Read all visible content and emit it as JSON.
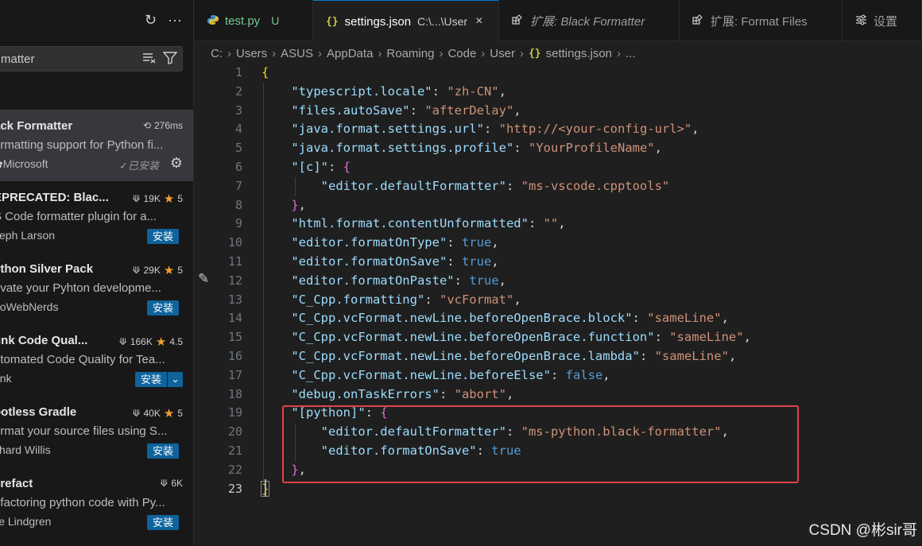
{
  "sidebar": {
    "actions": {
      "refresh_icon": "refresh-icon",
      "more_icon": "more-icon"
    },
    "search": {
      "value": "matter",
      "icons": [
        "clear-filter-icon",
        "filter-icon"
      ]
    },
    "extensions": [
      {
        "name": "ack Formatter",
        "description": "ormatting support for Python fi...",
        "publisher": "Microsoft",
        "stats": "276ms",
        "stat_icon": "history-icon",
        "status": "✓已安装",
        "selected": true
      },
      {
        "name": "EPRECATED: Blac...",
        "description": "S Code formatter plugin for a...",
        "publisher": "seph Larson",
        "downloads": "19K",
        "rating": "5",
        "install_label": "安装"
      },
      {
        "name": "ython Silver Pack",
        "description": "evate your Pyhton developme...",
        "publisher": "hoWebNerds",
        "downloads": "29K",
        "rating": "5",
        "install_label": "安装"
      },
      {
        "name": "unk Code Qual...",
        "description": "utomated Code Quality for Tea...",
        "publisher": "unk",
        "downloads": "166K",
        "rating": "4.5",
        "install_label": "安装",
        "split": true
      },
      {
        "name": "ootless Gradle",
        "description": "ormat your source files using S...",
        "publisher": "chard Willis",
        "downloads": "40K",
        "rating": "5",
        "install_label": "安装"
      },
      {
        "name": "yrefact",
        "description": "efactoring python code with Py...",
        "publisher": "lle Lindgren",
        "downloads": "6K",
        "install_label": "安装"
      }
    ]
  },
  "tabs": [
    {
      "icon": "python-icon",
      "label": "test.py",
      "badge": "U"
    },
    {
      "icon": "json-icon",
      "icon_text": "{}",
      "label": "settings.json",
      "path": "C:\\...\\User",
      "close": "×",
      "active": true
    },
    {
      "icon": "extension-icon",
      "label": "扩展: Black Formatter"
    },
    {
      "icon": "extension-icon",
      "label": "扩展: Format Files"
    },
    {
      "icon": "settings-icon",
      "label": "设置"
    }
  ],
  "breadcrumb": {
    "parts": [
      "C:",
      "Users",
      "ASUS",
      "AppData",
      "Roaming",
      "Code",
      "User"
    ],
    "file": "settings.json",
    "tail": "..."
  },
  "editor": {
    "line_numbers": [
      "1",
      "2",
      "3",
      "4",
      "5",
      "6",
      "7",
      "8",
      "9",
      "10",
      "11",
      "12",
      "13",
      "14",
      "15",
      "16",
      "17",
      "18",
      "19",
      "20",
      "21",
      "22",
      "23"
    ],
    "current_line": "23",
    "lines": [
      [
        [
          "br1",
          "{"
        ]
      ],
      [
        [
          "p",
          "    "
        ],
        [
          "k",
          "\"typescript.locale\""
        ],
        [
          "p",
          ": "
        ],
        [
          "s",
          "\"zh-CN\""
        ],
        [
          "p",
          ","
        ]
      ],
      [
        [
          "p",
          "    "
        ],
        [
          "k",
          "\"files.autoSave\""
        ],
        [
          "p",
          ": "
        ],
        [
          "s",
          "\"afterDelay\""
        ],
        [
          "p",
          ","
        ]
      ],
      [
        [
          "p",
          "    "
        ],
        [
          "k",
          "\"java.format.settings.url\""
        ],
        [
          "p",
          ": "
        ],
        [
          "s",
          "\"http://<your-config-url>\""
        ],
        [
          "p",
          ","
        ]
      ],
      [
        [
          "p",
          "    "
        ],
        [
          "k",
          "\"java.format.settings.profile\""
        ],
        [
          "p",
          ": "
        ],
        [
          "s",
          "\"YourProfileName\""
        ],
        [
          "p",
          ","
        ]
      ],
      [
        [
          "p",
          "    "
        ],
        [
          "k",
          "\"[c]\""
        ],
        [
          "p",
          ": "
        ],
        [
          "br2",
          "{"
        ]
      ],
      [
        [
          "p",
          "        "
        ],
        [
          "k",
          "\"editor.defaultFormatter\""
        ],
        [
          "p",
          ": "
        ],
        [
          "s",
          "\"ms-vscode.cpptools\""
        ]
      ],
      [
        [
          "p",
          "    "
        ],
        [
          "br2",
          "}"
        ],
        [
          "p",
          ","
        ]
      ],
      [
        [
          "p",
          "    "
        ],
        [
          "k",
          "\"html.format.contentUnformatted\""
        ],
        [
          "p",
          ": "
        ],
        [
          "s",
          "\"\""
        ],
        [
          "p",
          ","
        ]
      ],
      [
        [
          "p",
          "    "
        ],
        [
          "k",
          "\"editor.formatOnType\""
        ],
        [
          "p",
          ": "
        ],
        [
          "b",
          "true"
        ],
        [
          "p",
          ","
        ]
      ],
      [
        [
          "p",
          "    "
        ],
        [
          "k",
          "\"editor.formatOnSave\""
        ],
        [
          "p",
          ": "
        ],
        [
          "b",
          "true"
        ],
        [
          "p",
          ","
        ]
      ],
      [
        [
          "p",
          "    "
        ],
        [
          "k",
          "\"editor.formatOnPaste\""
        ],
        [
          "p",
          ": "
        ],
        [
          "b",
          "true"
        ],
        [
          "p",
          ","
        ]
      ],
      [
        [
          "p",
          "    "
        ],
        [
          "k",
          "\"C_Cpp.formatting\""
        ],
        [
          "p",
          ": "
        ],
        [
          "s",
          "\"vcFormat\""
        ],
        [
          "p",
          ","
        ]
      ],
      [
        [
          "p",
          "    "
        ],
        [
          "k",
          "\"C_Cpp.vcFormat.newLine.beforeOpenBrace.block\""
        ],
        [
          "p",
          ": "
        ],
        [
          "s",
          "\"sameLine\""
        ],
        [
          "p",
          ","
        ]
      ],
      [
        [
          "p",
          "    "
        ],
        [
          "k",
          "\"C_Cpp.vcFormat.newLine.beforeOpenBrace.function\""
        ],
        [
          "p",
          ": "
        ],
        [
          "s",
          "\"sameLine\""
        ],
        [
          "p",
          ","
        ]
      ],
      [
        [
          "p",
          "    "
        ],
        [
          "k",
          "\"C_Cpp.vcFormat.newLine.beforeOpenBrace.lambda\""
        ],
        [
          "p",
          ": "
        ],
        [
          "s",
          "\"sameLine\""
        ],
        [
          "p",
          ","
        ]
      ],
      [
        [
          "p",
          "    "
        ],
        [
          "k",
          "\"C_Cpp.vcFormat.newLine.beforeElse\""
        ],
        [
          "p",
          ": "
        ],
        [
          "b",
          "false"
        ],
        [
          "p",
          ","
        ]
      ],
      [
        [
          "p",
          "    "
        ],
        [
          "k",
          "\"debug.onTaskErrors\""
        ],
        [
          "p",
          ": "
        ],
        [
          "s",
          "\"abort\""
        ],
        [
          "p",
          ","
        ]
      ],
      [
        [
          "p",
          "    "
        ],
        [
          "k",
          "\"[python]\""
        ],
        [
          "p",
          ": "
        ],
        [
          "br2",
          "{"
        ]
      ],
      [
        [
          "p",
          "        "
        ],
        [
          "k",
          "\"editor.defaultFormatter\""
        ],
        [
          "p",
          ": "
        ],
        [
          "s",
          "\"ms-python.black-formatter\""
        ],
        [
          "p",
          ","
        ]
      ],
      [
        [
          "p",
          "        "
        ],
        [
          "k",
          "\"editor.formatOnSave\""
        ],
        [
          "p",
          ": "
        ],
        [
          "b",
          "true"
        ]
      ],
      [
        [
          "p",
          "    "
        ],
        [
          "br2",
          "}"
        ],
        [
          "p",
          ","
        ]
      ],
      [
        [
          "br1 match",
          "}"
        ]
      ]
    ]
  },
  "colors": {
    "accent": "#0078d4",
    "highlight_box": "#e0424d",
    "install_button": "#0e639c",
    "star": "#f3a02b"
  },
  "watermark": "CSDN @彬sir哥"
}
